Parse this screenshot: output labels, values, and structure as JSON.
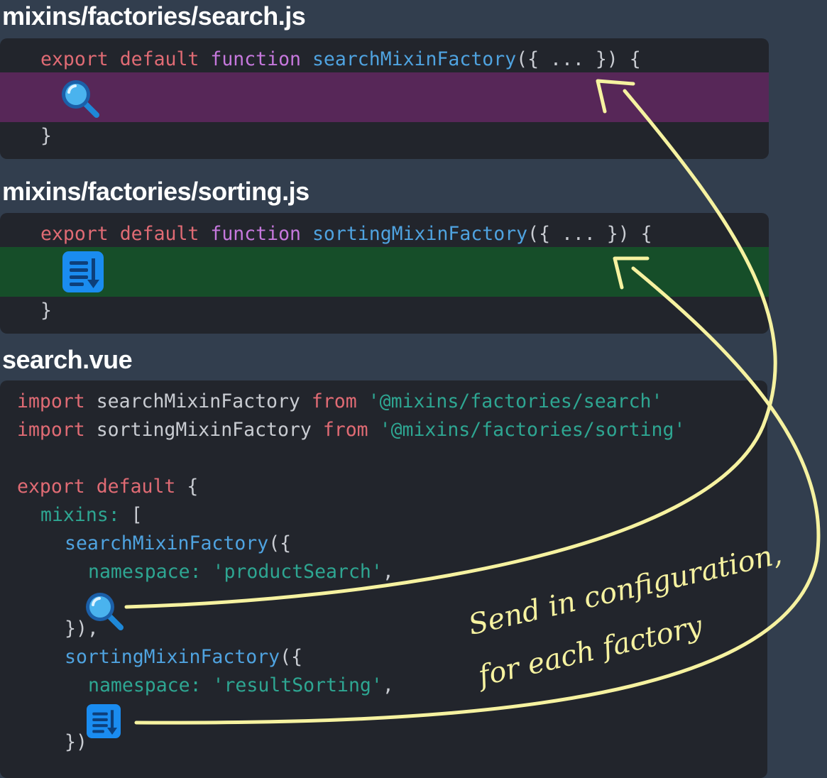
{
  "files": {
    "search_js": {
      "title": "mixins/factories/search.js",
      "line1": {
        "export": "export",
        "default": "default",
        "function": "function",
        "name": "searchMixinFactory",
        "args": "({ ... }) {"
      },
      "close": "}",
      "icon": "magnifier-icon",
      "band_color": "#572758"
    },
    "sorting_js": {
      "title": "mixins/factories/sorting.js",
      "line1": {
        "export": "export",
        "default": "default",
        "function": "function",
        "name": "sortingMixinFactory",
        "args": "({ ... }) {"
      },
      "close": "}",
      "icon": "sort-list-icon",
      "band_color": "#164e29"
    },
    "search_vue": {
      "title": "search.vue",
      "import1": {
        "kw": "import",
        "name": "searchMixinFactory",
        "from": "from",
        "path": "'@mixins/factories/search'"
      },
      "import2": {
        "kw": "import",
        "name": "sortingMixinFactory",
        "from": "from",
        "path": "'@mixins/factories/sorting'"
      },
      "export_line": {
        "export": "export",
        "default": "default",
        "brace": "{"
      },
      "mixins_line": {
        "prop": "mixins:",
        "bracket": "["
      },
      "search_call": {
        "name": "searchMixinFactory",
        "open": "({"
      },
      "search_ns": {
        "prop": "namespace:",
        "value": "'productSearch'",
        "comma": ","
      },
      "search_close": "}),",
      "sorting_call": {
        "name": "sortingMixinFactory",
        "open": "({"
      },
      "sorting_ns": {
        "prop": "namespace:",
        "value": "'resultSorting'",
        "comma": ","
      },
      "sorting_close": "})"
    }
  },
  "annotation": {
    "line1": "Send in configuration,",
    "line2": "for each factory",
    "color": "#f6f2a0"
  },
  "colors": {
    "background": "#323e4e",
    "panel": "#22252c",
    "keyword": "#e06b74",
    "function_kw": "#c678dd",
    "function_name": "#4fa3e0",
    "string": "#2ea692"
  }
}
